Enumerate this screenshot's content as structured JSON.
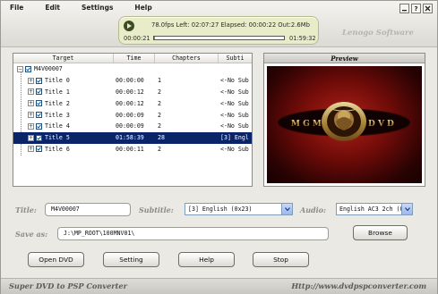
{
  "menu": [
    "File",
    "Edit",
    "Settings",
    "Help"
  ],
  "status": {
    "stats": "78.0fps Left: 02:07:27 Elapsed: 00:00:22 Out:2.6Mb",
    "current_time": "00:00:21",
    "total_time": "01:59:32",
    "progress_fraction": 0.003
  },
  "brand": "Lenogo Software",
  "table": {
    "columns": [
      "Target",
      "Time",
      "Chapters",
      "Subti"
    ],
    "root": "M4V00007",
    "rows": [
      {
        "name": "Title 0",
        "time": "00:00:00",
        "chapters": "1",
        "subtitle": "<-No Sub"
      },
      {
        "name": "Title 1",
        "time": "00:00:12",
        "chapters": "2",
        "subtitle": "<-No Sub"
      },
      {
        "name": "Title 2",
        "time": "00:00:12",
        "chapters": "2",
        "subtitle": "<-No Sub"
      },
      {
        "name": "Title 3",
        "time": "00:00:09",
        "chapters": "2",
        "subtitle": "<-No Sub"
      },
      {
        "name": "Title 4",
        "time": "00:00:09",
        "chapters": "2",
        "subtitle": "<-No Sub"
      },
      {
        "name": "Title 5",
        "time": "01:58:39",
        "chapters": "28",
        "subtitle": "[3] Engl",
        "selected": true
      },
      {
        "name": "Title 6",
        "time": "00:00:11",
        "chapters": "2",
        "subtitle": "<-No Sub"
      }
    ]
  },
  "preview": {
    "title": "Preview",
    "logo_left": "M G M",
    "logo_right": "D V D"
  },
  "form": {
    "title_label": "Title:",
    "title_value": "M4V00007",
    "subtitle_label": "Subtitle:",
    "subtitle_value": "[3] English (0x23)",
    "audio_label": "Audio:",
    "audio_value": "English AC3 2ch (0:",
    "save_label": "Save as:",
    "save_value": "J:\\MP_ROOT\\100MNV01\\",
    "browse_label": "Browse"
  },
  "buttons": {
    "open_dvd": "Open DVD",
    "setting": "Setting",
    "help": "Help",
    "stop": "Stop"
  },
  "footer": {
    "left": "Super DVD to PSP Converter",
    "right": "Http://www.dvdpspconverter.com"
  },
  "colors": {
    "selection": "#0a246a",
    "status_panel": "#e9ecc9",
    "preview_red": "#b22018"
  }
}
